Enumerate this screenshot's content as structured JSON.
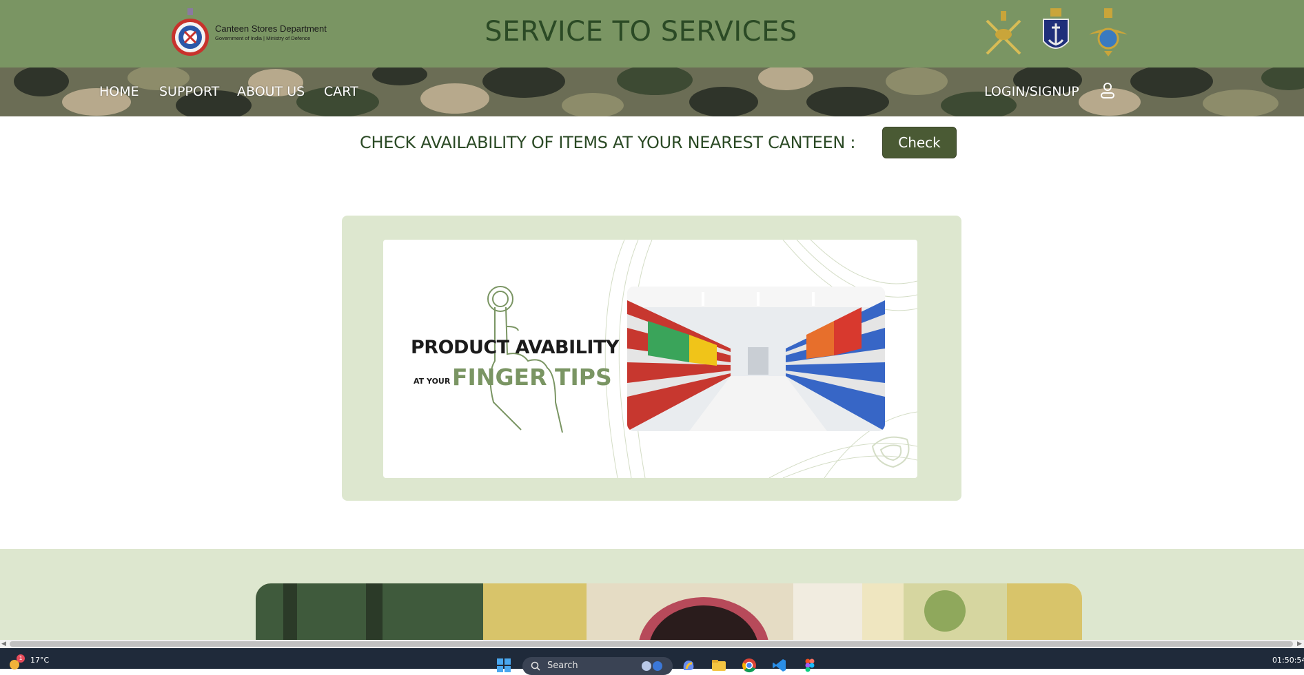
{
  "header": {
    "org_name": "Canteen Stores Department",
    "org_subtitle": "Government of India | Ministry of Defence",
    "site_title": "SERVICE TO SERVICES"
  },
  "nav": {
    "items": [
      {
        "label": "HOME"
      },
      {
        "label": "SUPPORT"
      },
      {
        "label": "ABOUT US"
      },
      {
        "label": "CART"
      }
    ],
    "login_label": "LOGIN/SIGNUP"
  },
  "availability": {
    "text": "CHECK AVAILABILITY OF ITEMS AT YOUR NEAREST CANTEEN :",
    "button_label": "Check"
  },
  "banner": {
    "heading": "PRODUCT AVABILITY",
    "at_your": "AT YOUR",
    "highlight": "FINGER TIPS"
  },
  "taskbar": {
    "notification_count": "1",
    "weather": "17°C",
    "search_label": "Search",
    "clock": "01:50:54"
  },
  "colors": {
    "header_green": "#7a9563",
    "title_green": "#2b4a25",
    "button_green": "#4a5a34",
    "banner_bg": "#dde7cf"
  }
}
